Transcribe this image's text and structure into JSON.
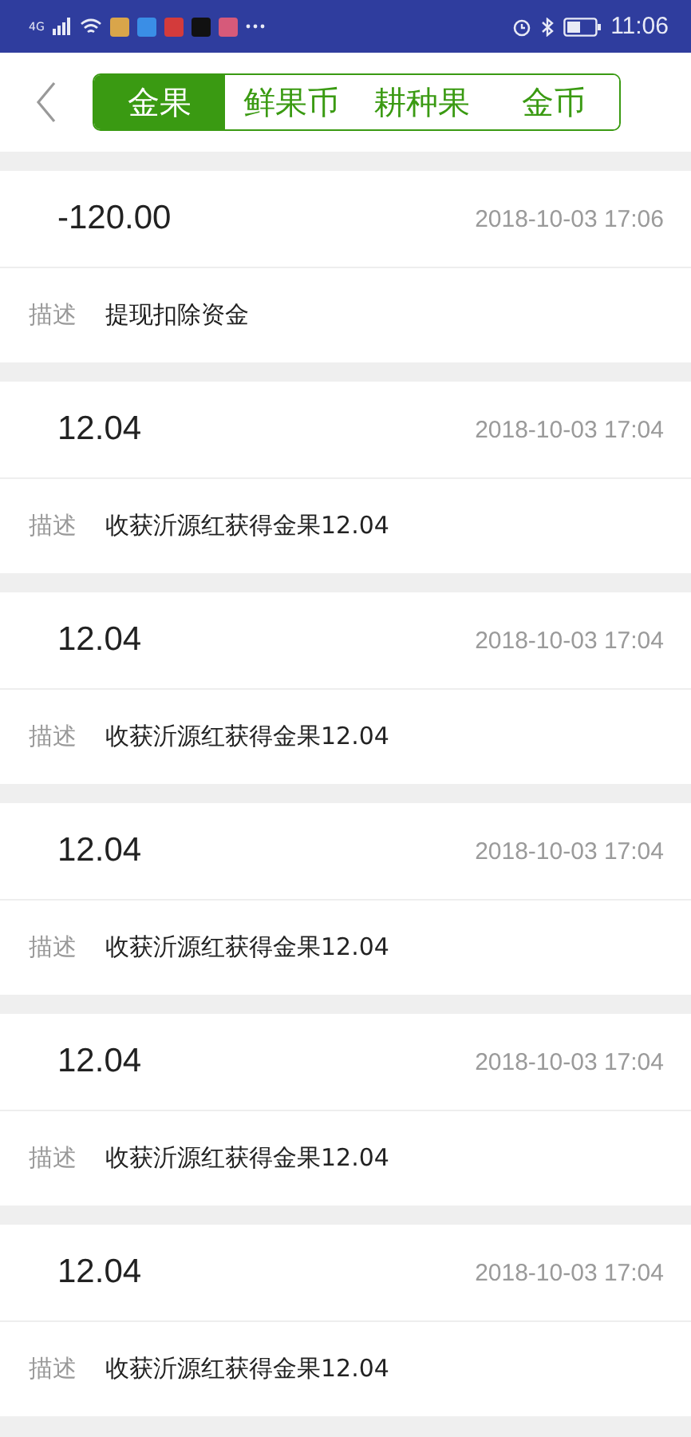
{
  "status_bar": {
    "time": "11:06",
    "network": "4G"
  },
  "tabs": [
    {
      "label": "金果",
      "selected": true
    },
    {
      "label": "鲜果币",
      "selected": false
    },
    {
      "label": "耕种果",
      "selected": false
    },
    {
      "label": "金币",
      "selected": false
    }
  ],
  "records": [
    {
      "amount": "-120.00",
      "time": "2018-10-03 17:06",
      "desc_label": "描述",
      "desc": "提现扣除资金"
    },
    {
      "amount": "12.04",
      "time": "2018-10-03 17:04",
      "desc_label": "描述",
      "desc": "收获沂源红获得金果12.04"
    },
    {
      "amount": "12.04",
      "time": "2018-10-03 17:04",
      "desc_label": "描述",
      "desc": "收获沂源红获得金果12.04"
    },
    {
      "amount": "12.04",
      "time": "2018-10-03 17:04",
      "desc_label": "描述",
      "desc": "收获沂源红获得金果12.04"
    },
    {
      "amount": "12.04",
      "time": "2018-10-03 17:04",
      "desc_label": "描述",
      "desc": "收获沂源红获得金果12.04"
    },
    {
      "amount": "12.04",
      "time": "2018-10-03 17:04",
      "desc_label": "描述",
      "desc": "收获沂源红获得金果12.04"
    }
  ]
}
